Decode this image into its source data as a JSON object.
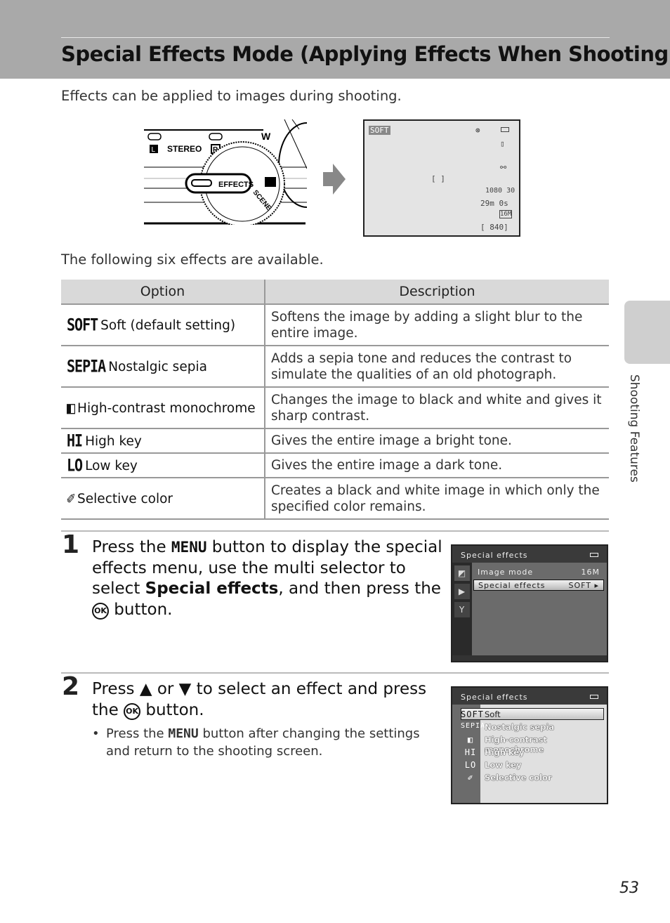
{
  "header": {
    "title": "Special Effects Mode (Applying Effects When Shooting)"
  },
  "intro": "Effects can be applied to images during shooting.",
  "dial": {
    "stereo": "STEREO",
    "left": "L",
    "right": "R",
    "w": "W",
    "effects": "EFFECTS",
    "scene": "SCENE",
    "scene_small": "SCENE"
  },
  "lcd": {
    "effect": "SOFT",
    "movie": "1080 30",
    "time": "29m 0s",
    "size": "16M",
    "shots": "[ 840]",
    "brackets": "[   ]"
  },
  "available_text": "The following six effects are available.",
  "table": {
    "headers": [
      "Option",
      "Description"
    ],
    "rows": [
      {
        "symbol": "SOFT",
        "option": "Soft (default setting)",
        "description": "Softens the image by adding a slight blur to the entire image."
      },
      {
        "symbol": "SEPIA",
        "option": "Nostalgic sepia",
        "description": "Adds a sepia tone and reduces the contrast to simulate the qualities of an old photograph."
      },
      {
        "symbol": "◧",
        "option": "High-contrast monochrome",
        "description": "Changes the image to black and white and gives it sharp contrast."
      },
      {
        "symbol": "HI",
        "option": "High key",
        "description": "Gives the entire image a bright tone."
      },
      {
        "symbol": "LO",
        "option": "Low key",
        "description": "Gives the entire image a dark tone."
      },
      {
        "symbol": "✐",
        "option": "Selective color",
        "description": "Creates a black and white image in which only the specified color remains."
      }
    ]
  },
  "step1": {
    "number": "1",
    "t1": "Press the ",
    "menu": "MENU",
    "t2": " button to display the special effects menu, use the multi selector to select ",
    "bold": "Special effects",
    "t3": ", and then press the ",
    "ok": "OK",
    "t4": " button.",
    "screen": {
      "title": "Special effects",
      "item1": "Image mode",
      "item1_value": "16M",
      "item2": "Special effects",
      "item2_value": "SOFT ▸"
    }
  },
  "step2": {
    "number": "2",
    "t1": "Press ▲ or ▼ to select an effect and press the ",
    "ok": "OK",
    "t2": " button.",
    "bullet_a": "Press the ",
    "menu": "MENU",
    "bullet_b": " button after changing the settings and return to the shooting screen.",
    "screen": {
      "title": "Special effects",
      "items": [
        {
          "icon": "SOFT",
          "label": "Soft"
        },
        {
          "icon": "SEPIA",
          "label": "Nostalgic sepia"
        },
        {
          "icon": "◧",
          "label": "High-contrast monochrome"
        },
        {
          "icon": "HI",
          "label": "High key"
        },
        {
          "icon": "LO",
          "label": "Low key"
        },
        {
          "icon": "✐",
          "label": "Selective color"
        }
      ]
    }
  },
  "side_tab": "Shooting Features",
  "page_number": "53"
}
